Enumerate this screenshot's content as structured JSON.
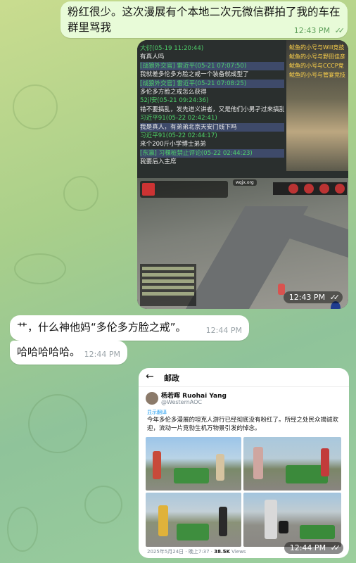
{
  "messages": [
    {
      "text": "粉红很少。这次漫展有个本地二次元微信群拍了我的车在群里骂我",
      "time": "12:43 PM",
      "ticks": "✓✓"
    },
    {
      "text": "艹，什么神他妈“多伦多方脸之戒”。",
      "time": "12:44 PM"
    },
    {
      "text": "哈哈哈哈哈。",
      "time": "12:44 PM"
    }
  ],
  "screenshot_msg": {
    "time": "12:43 PM",
    "ticks": "✓✓",
    "chat_log": [
      {
        "kind": "name",
        "text": "大衍(05-19 11:20:44)"
      },
      {
        "kind": "text",
        "text": "有真人吗"
      },
      {
        "kind": "name",
        "text": "[战狼外交官] 雷近平(05-21 07:07:50)",
        "hl": true
      },
      {
        "kind": "text",
        "text": "我就差多伦多方脸之戒一个装备就成型了"
      },
      {
        "kind": "name",
        "text": "[战狼外交官] 雷近平(05-21 07:08:25)",
        "hl": true
      },
      {
        "kind": "text",
        "text": "多伦多方脸之戒怎么获得"
      },
      {
        "kind": "name",
        "text": "52jl安(05-21 09:24:36)"
      },
      {
        "kind": "text",
        "text": "错不要搞乱，发先进义讲者，又是他们小男孑过来搞乱了"
      },
      {
        "kind": "name",
        "text": "习近平91(05-22 02:42:41)"
      },
      {
        "kind": "text",
        "text": "我是真人，有弟弟北京天安门线下吗",
        "hl": true
      },
      {
        "kind": "name",
        "text": "习近平91(05-22 02:44:17)"
      },
      {
        "kind": "text",
        "text": "来个200斤小学博士弟弟"
      },
      {
        "kind": "name",
        "text": "[东瀛] 习棵桩禁止评论(05-22 02:44:23)",
        "hl": true
      },
      {
        "kind": "text",
        "text": "我要后入主席"
      }
    ],
    "right_log": [
      "鱿鱼的小号与Will竞技",
      "鱿鱼的小号与野田佳彦",
      "鱿鱼的小号与CCCP竞",
      "鱿鱼的小号与管宴竞技"
    ],
    "site_label": "wqjx.org"
  },
  "tweet": {
    "header_title": "邮政",
    "back_icon": "back-arrow-icon",
    "author_name": "杨若晖 Ruohai Yang",
    "author_handle": "@WesternAOC",
    "translate_label": "显示翻译",
    "body": "今年多伦多漫展的坦克人游行已经彻底没有粉红了。所经之处民众竭诚欢迎，流动一片竞勃生机万物景引发的悼念。",
    "date": "2025年5月24日 · 晚上7:37 · ",
    "views": "38.5K",
    "views_label": " Views",
    "time": "12:44 PM",
    "ticks": "✓✓"
  },
  "colors": {
    "outgoing_bubble": "#e8fbd8",
    "incoming_bubble": "#ffffff",
    "out_meta": "#5fa05b",
    "chat_name_green": "#4fd06a",
    "log_yellow": "#ffd34a",
    "link_blue": "#1d9bf0"
  }
}
